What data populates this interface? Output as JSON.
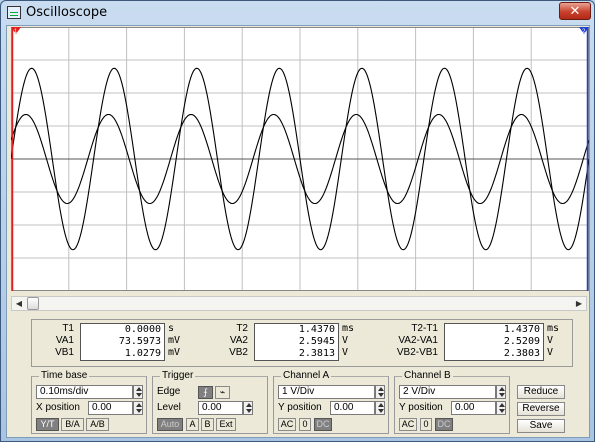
{
  "window": {
    "title": "Oscilloscope",
    "close_glyph": "✕"
  },
  "cursors": {
    "t1_label": "1",
    "t2_label": "2"
  },
  "scrollbar": {
    "left_arrow": "◀",
    "right_arrow": "▶"
  },
  "readout": {
    "left": {
      "labels": [
        "T1",
        "VA1",
        "VB1"
      ],
      "values": [
        "0.0000",
        "73.5973",
        "1.0279"
      ],
      "units": [
        "s",
        "mV",
        "mV"
      ]
    },
    "middle": {
      "labels": [
        "T2",
        "VA2",
        "VB2"
      ],
      "values": [
        "1.4370",
        "2.5945",
        "2.3813"
      ],
      "units": [
        "ms",
        "V",
        "V"
      ]
    },
    "right": {
      "labels": [
        "T2-T1",
        "VA2-VA1",
        "VB2-VB1"
      ],
      "values": [
        "1.4370",
        "2.5209",
        "2.3803"
      ],
      "units": [
        "ms",
        "V",
        "V"
      ]
    }
  },
  "timebase": {
    "title": "Time base",
    "value": "0.10ms/div",
    "xpos_label": "X position",
    "xpos_value": "0.00",
    "buttons": [
      "Y/T",
      "B/A",
      "A/B"
    ]
  },
  "trigger": {
    "title": "Trigger",
    "edge_label": "Edge",
    "level_label": "Level",
    "level_value": "0.00",
    "edge_rising": "⨍",
    "edge_falling": "⌁",
    "buttons": [
      "Auto",
      "A",
      "B",
      "Ext"
    ]
  },
  "channel_a": {
    "title": "Channel A",
    "value": "1 V/Div",
    "ypos_label": "Y position",
    "ypos_value": "0.00",
    "buttons": [
      "AC",
      "0",
      "DC"
    ]
  },
  "channel_b": {
    "title": "Channel B",
    "value": "2 V/Div",
    "ypos_label": "Y position",
    "ypos_value": "0.00",
    "buttons": [
      "AC",
      "0",
      "DC"
    ]
  },
  "actions": [
    "Reduce",
    "Reverse",
    "Save"
  ],
  "colors": {
    "grid": "#c0c0c0",
    "axis": "#000000",
    "trace": "#000000",
    "cursor1": "#e02020",
    "cursor2": "#2040d0"
  },
  "traces": {
    "periods_visible": 7,
    "big_amplitude_divs": 2.75,
    "small_amplitude_divs": 1.35,
    "small_phase_lead_deg": 25
  }
}
